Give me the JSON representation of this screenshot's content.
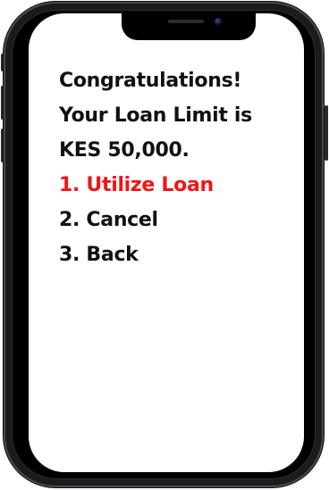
{
  "ussd_screen": {
    "message_lines": [
      "Congratulations!",
      "Your Loan Limit is",
      "KES 50,000."
    ],
    "options": [
      {
        "label": "1. Utilize Loan",
        "highlighted": true
      },
      {
        "label": "2. Cancel",
        "highlighted": false
      },
      {
        "label": "3. Back",
        "highlighted": false
      }
    ]
  },
  "colors": {
    "text": "#111111",
    "highlight": "#f01515",
    "screen_background": "#ffffff",
    "phone_body": "#1b1b1d"
  }
}
